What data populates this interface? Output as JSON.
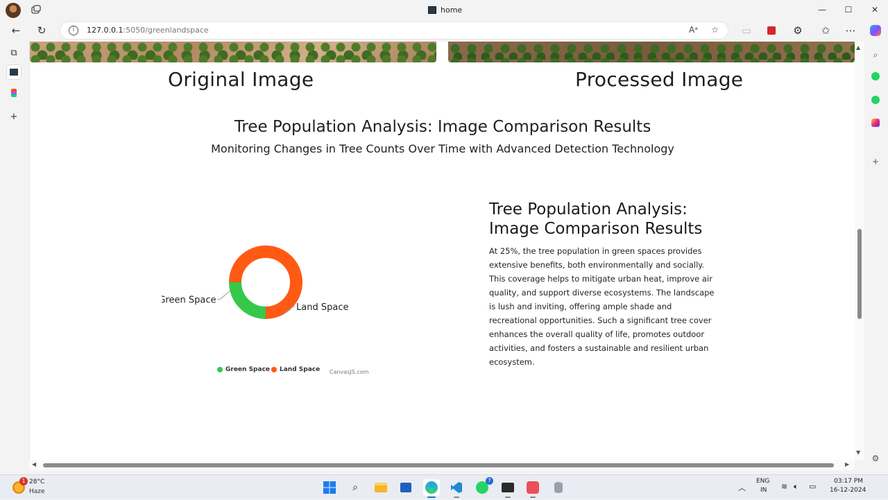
{
  "browser": {
    "tab_title": "home",
    "url_host": "127.0.0.1",
    "url_rest": ":5050/greenlandspace",
    "window_controls": [
      "—",
      "☐",
      "✕"
    ]
  },
  "page": {
    "original_caption": "Original Image",
    "processed_caption": "Processed Image",
    "main_title": "Tree Population Analysis: Image Comparison Results",
    "main_subtitle": "Monitoring Changes in Tree Counts Over Time with Advanced Detection Technology",
    "analysis_title": "Tree Population Analysis: Image Comparison Results",
    "analysis_body": "At 25%, the tree population in green spaces provides extensive benefits, both environmentally and socially. This coverage helps to mitigate urban heat, improve air quality, and support diverse ecosystems. The landscape is lush and inviting, offering ample shade and recreational opportunities. Such a significant tree cover enhances the overall quality of life, promotes outdoor activities, and fosters a sustainable and resilient urban ecosystem.",
    "chart_credit": "CanvasJS.com"
  },
  "chart_data": {
    "type": "pie",
    "subtype": "doughnut",
    "categories": [
      "Green Space",
      "Land Space"
    ],
    "values": [
      25,
      75
    ],
    "colors": [
      "#36c84a",
      "#ff5a14"
    ],
    "legend": "bottom",
    "labels_outside": true
  },
  "taskbar": {
    "weather_temp": "28°C",
    "weather_cond": "Haze",
    "weather_badge": "1",
    "whatsapp_count": "7",
    "lang_top": "ENG",
    "lang_bottom": "IN",
    "time": "03:17 PM",
    "date": "16-12-2024"
  }
}
